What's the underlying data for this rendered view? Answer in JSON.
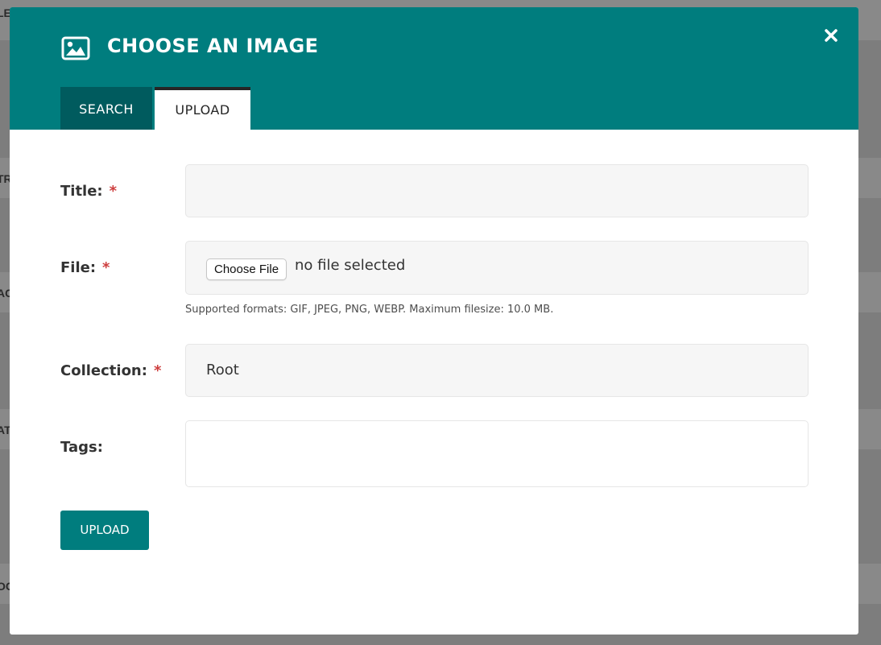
{
  "background": {
    "fragments": [
      "LE",
      "TR",
      "AC",
      "AT",
      "OC"
    ]
  },
  "modal": {
    "title": "CHOOSE AN IMAGE",
    "header_icon": "image-icon",
    "close_icon": "close-icon",
    "tabs": [
      {
        "label": "SEARCH",
        "active": false
      },
      {
        "label": "UPLOAD",
        "active": true
      }
    ]
  },
  "form": {
    "title": {
      "label": "Title:",
      "required": "*",
      "value": ""
    },
    "file": {
      "label": "File:",
      "required": "*",
      "button_label": "Choose File",
      "status": "no file selected",
      "help": "Supported formats: GIF, JPEG, PNG, WEBP. Maximum filesize: 10.0 MB."
    },
    "collection": {
      "label": "Collection:",
      "required": "*",
      "selected": "Root"
    },
    "tags": {
      "label": "Tags:",
      "value": ""
    },
    "submit_label": "UPLOAD"
  },
  "colors": {
    "header": "#007d7e",
    "active_tab_bg": "#ffffff",
    "inactive_tab_bg": "#005b5e",
    "required": "#cd3d3d",
    "overlay": "#7d7d7d"
  }
}
